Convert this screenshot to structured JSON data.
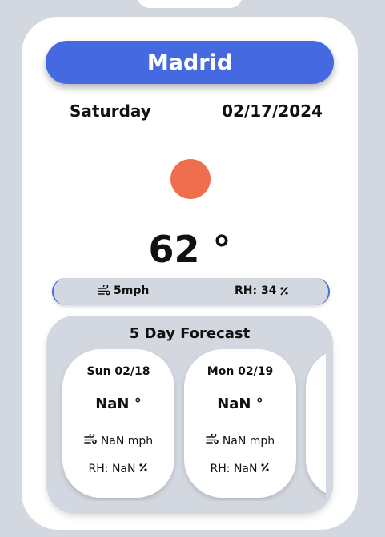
{
  "city": "Madrid",
  "day": "Saturday",
  "date": "02/17/2024",
  "weather_icon": "sun-icon",
  "temperature": "62 °",
  "wind": "5mph",
  "humidity": "RH: 34",
  "forecast": {
    "title": "5 Day Forecast",
    "days": [
      {
        "date": "Sun 02/18",
        "temp": "NaN °",
        "wind": "NaN mph",
        "rh": "RH: NaN"
      },
      {
        "date": "Mon 02/19",
        "temp": "NaN °",
        "wind": "NaN mph",
        "rh": "RH: NaN"
      }
    ]
  },
  "colors": {
    "accent": "#4469e0",
    "sun": "#ee6e4f",
    "background": "#d3d8e0"
  }
}
